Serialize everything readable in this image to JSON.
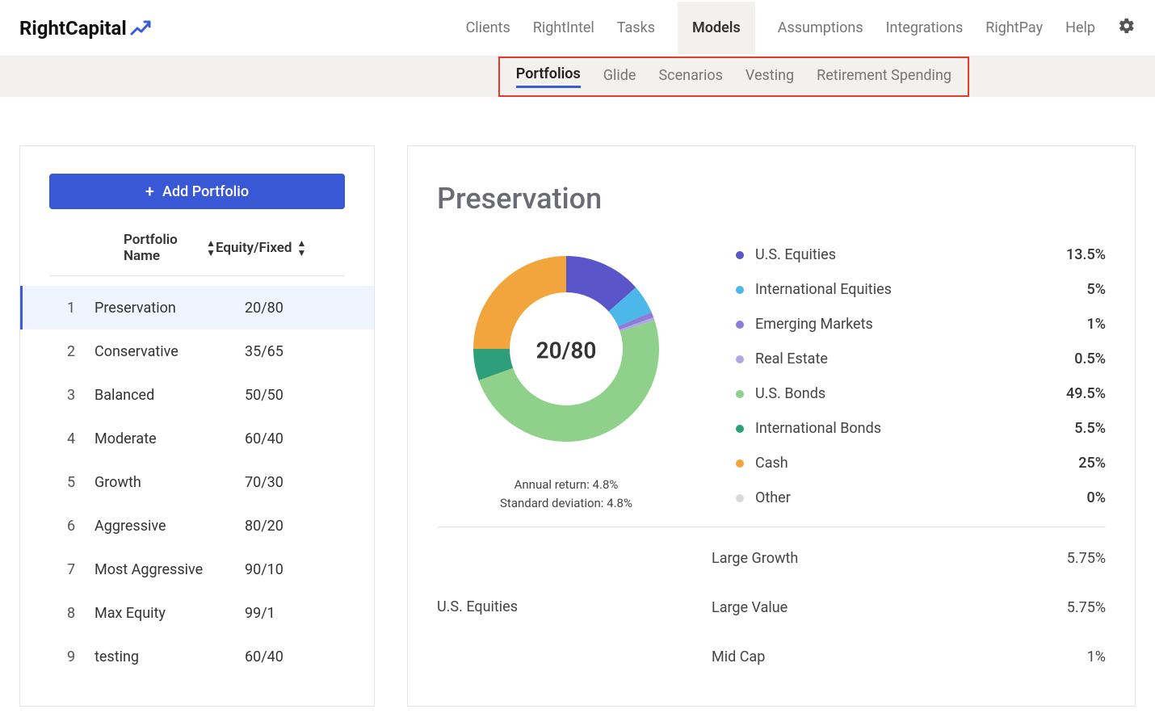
{
  "brand": "RightCapital",
  "topnav": {
    "items": [
      "Clients",
      "RightIntel",
      "Tasks",
      "Models",
      "Assumptions",
      "Integrations",
      "RightPay",
      "Help"
    ],
    "active": "Models"
  },
  "subnav": {
    "items": [
      "Portfolios",
      "Glide",
      "Scenarios",
      "Vesting",
      "Retirement Spending"
    ],
    "active": "Portfolios"
  },
  "left": {
    "add_label": "Add Portfolio",
    "col_name": "Portfolio Name",
    "col_ratio": "Equity/Fixed",
    "rows": [
      {
        "idx": "1",
        "name": "Preservation",
        "ratio": "20/80",
        "selected": true
      },
      {
        "idx": "2",
        "name": "Conservative",
        "ratio": "35/65"
      },
      {
        "idx": "3",
        "name": "Balanced",
        "ratio": "50/50"
      },
      {
        "idx": "4",
        "name": "Moderate",
        "ratio": "60/40"
      },
      {
        "idx": "5",
        "name": "Growth",
        "ratio": "70/30"
      },
      {
        "idx": "6",
        "name": "Aggressive",
        "ratio": "80/20"
      },
      {
        "idx": "7",
        "name": "Most Aggressive",
        "ratio": "90/10"
      },
      {
        "idx": "8",
        "name": "Max Equity",
        "ratio": "99/1"
      },
      {
        "idx": "9",
        "name": "testing",
        "ratio": "60/40"
      }
    ]
  },
  "detail": {
    "title": "Preservation",
    "center_label": "20/80",
    "annual_return_label": "Annual return: 4.8%",
    "std_dev_label": "Standard deviation: 4.8%",
    "legend": [
      {
        "name": "U.S. Equities",
        "pct": "13.5%",
        "color": "#5a55c9"
      },
      {
        "name": "International Equities",
        "pct": "5%",
        "color": "#4cb8ea"
      },
      {
        "name": "Emerging Markets",
        "pct": "1%",
        "color": "#8a7cd8"
      },
      {
        "name": "Real Estate",
        "pct": "0.5%",
        "color": "#b1a8e3"
      },
      {
        "name": "U.S. Bonds",
        "pct": "49.5%",
        "color": "#8fd18b"
      },
      {
        "name": "International Bonds",
        "pct": "5.5%",
        "color": "#2f9e7a"
      },
      {
        "name": "Cash",
        "pct": "25%",
        "color": "#f2a53c"
      },
      {
        "name": "Other",
        "pct": "0%",
        "color": "#d9d9d9"
      }
    ],
    "subcat_title": "U.S. Equities",
    "subcats": [
      {
        "name": "Large Growth",
        "pct": "5.75%"
      },
      {
        "name": "Large Value",
        "pct": "5.75%"
      },
      {
        "name": "Mid Cap",
        "pct": "1%"
      }
    ]
  },
  "chart_data": {
    "type": "pie",
    "title": "Preservation",
    "series": [
      {
        "name": "U.S. Equities",
        "value": 13.5,
        "color": "#5a55c9"
      },
      {
        "name": "International Equities",
        "value": 5,
        "color": "#4cb8ea"
      },
      {
        "name": "Emerging Markets",
        "value": 1,
        "color": "#8a7cd8"
      },
      {
        "name": "Real Estate",
        "value": 0.5,
        "color": "#b1a8e3"
      },
      {
        "name": "U.S. Bonds",
        "value": 49.5,
        "color": "#8fd18b"
      },
      {
        "name": "International Bonds",
        "value": 5.5,
        "color": "#2f9e7a"
      },
      {
        "name": "Cash",
        "value": 25,
        "color": "#f2a53c"
      },
      {
        "name": "Other",
        "value": 0,
        "color": "#d9d9d9"
      }
    ],
    "center_text": "20/80",
    "annual_return": 4.8,
    "standard_deviation": 4.8
  }
}
